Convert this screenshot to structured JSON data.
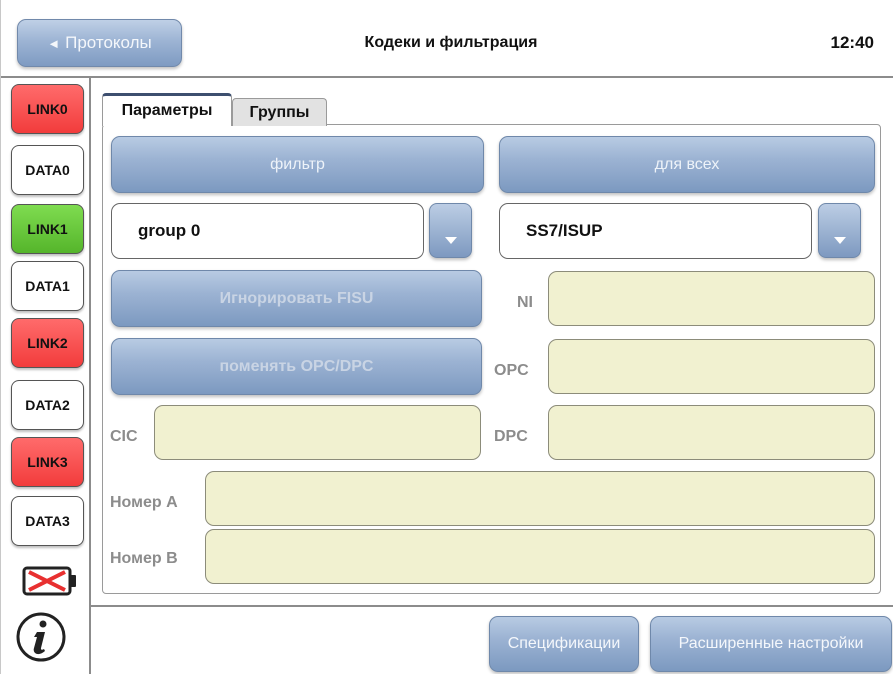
{
  "header": {
    "back_label": "Протоколы",
    "title": "Кодеки и фильтрация",
    "time": "12:40"
  },
  "sidebar": {
    "items": [
      {
        "label": "LINK0",
        "color": "#f23c3c"
      },
      {
        "label": "DATA0",
        "color": "#ffffff"
      },
      {
        "label": "LINK1",
        "color": "#55b52b"
      },
      {
        "label": "DATA1",
        "color": "#ffffff"
      },
      {
        "label": "LINK2",
        "color": "#f23c3c"
      },
      {
        "label": "DATA2",
        "color": "#ffffff"
      },
      {
        "label": "LINK3",
        "color": "#f23c3c"
      },
      {
        "label": "DATA3",
        "color": "#ffffff"
      }
    ],
    "battery_icon": "battery-empty-icon",
    "info_icon": "info-icon"
  },
  "tabs": [
    {
      "label": "Параметры",
      "active": true
    },
    {
      "label": "Группы",
      "active": false
    }
  ],
  "form": {
    "filter_button": "фильтр",
    "for_all_button": "для всех",
    "group_select": "group 0",
    "protocol_select": "SS7/ISUP",
    "ignore_fisu_button": "Игнорировать FISU",
    "swap_opc_dpc_button": "поменять OPC/DPC",
    "ni_label": "NI",
    "ni_value": "",
    "opc_label": "OPC",
    "opc_value": "",
    "cic_label": "CIC",
    "cic_value": "",
    "dpc_label": "DPC",
    "dpc_value": "",
    "number_a_label": "Номер A",
    "number_a_value": "",
    "number_b_label": "Номер B",
    "number_b_value": ""
  },
  "footer": {
    "specs_button": "Спецификации",
    "advanced_button": "Расширенные настройки"
  }
}
